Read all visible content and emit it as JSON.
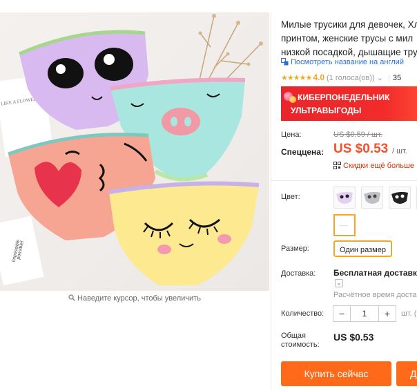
{
  "product": {
    "title_lines": [
      "Милые трусики для девочек, Хл",
      "принтом, женские трусы с мил",
      "низкой посадкой, дышащие тру"
    ],
    "translate_link": "Посмотреть название на англий",
    "rating": {
      "stars": "★★★★★",
      "value": "4.0",
      "votes": "(1 голоса(ов))",
      "orders": "35"
    }
  },
  "banner": {
    "line1": "КИБЕРПОНЕДЕЛЬНИК",
    "line2": "УЛЬТРАВЫГОДЫ"
  },
  "price": {
    "label": "Цена:",
    "old": "US $0.59 / шт.",
    "special_label": "Спеццена:",
    "new": "US $0.53",
    "unit": "/ шт.",
    "discount_text": "Скидки ещё больше"
  },
  "options": {
    "color_label": "Цвет:",
    "size_label": "Размер:",
    "size_value": "Один размер",
    "selected_color_index": 4
  },
  "shipping": {
    "label": "Доставка:",
    "title": "Бесплатная доставка в",
    "time": "Расчётное время достав"
  },
  "quantity": {
    "label": "Количество:",
    "minus": "−",
    "value": "1",
    "plus": "+",
    "note": "шт. (2"
  },
  "total": {
    "label_line1": "Общая",
    "label_line2": "стоимость:",
    "value": "US $0.53"
  },
  "actions": {
    "buy_now": "Купить сейчас",
    "add_to_cart": "Д"
  },
  "gallery": {
    "zoom_hint": "Наведите курсор, чтобы увеличить",
    "card_text_1": "LIKE A FLOWER",
    "card_text_2": "impossible",
    "card_text_3": "possible!"
  },
  "colors": {
    "accent": "#ff6a1a",
    "price": "#f2522e",
    "star": "#f5a623",
    "link": "#2b6fd6"
  }
}
